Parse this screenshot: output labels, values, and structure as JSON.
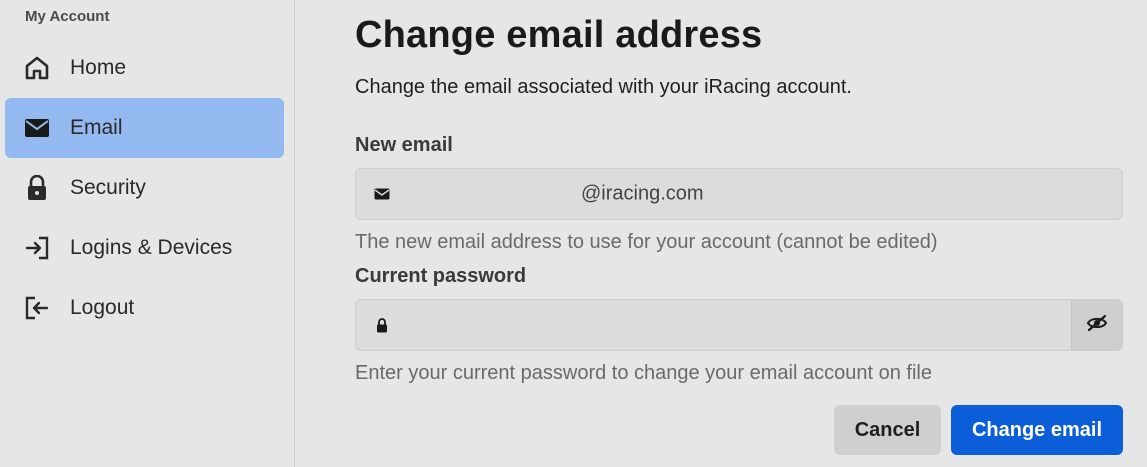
{
  "sidebar": {
    "heading": "My Account",
    "items": [
      {
        "label": "Home",
        "icon": "home-icon",
        "active": false
      },
      {
        "label": "Email",
        "icon": "envelope-icon",
        "active": true
      },
      {
        "label": "Security",
        "icon": "lock-icon",
        "active": false
      },
      {
        "label": "Logins & Devices",
        "icon": "login-icon",
        "active": false
      },
      {
        "label": "Logout",
        "icon": "logout-icon",
        "active": false
      }
    ]
  },
  "main": {
    "title": "Change email address",
    "description": "Change the email associated with your iRacing account.",
    "new_email": {
      "label": "New email",
      "value": "@iracing.com",
      "help": "The new email address to use for your account (cannot be edited)"
    },
    "current_password": {
      "label": "Current password",
      "value": "",
      "help": "Enter your current password to change your email account on file"
    },
    "buttons": {
      "cancel": "Cancel",
      "submit": "Change email"
    }
  },
  "colors": {
    "accent": "#0b5ed7",
    "active_nav": "#93b9f0",
    "background": "#e6e6e6"
  }
}
